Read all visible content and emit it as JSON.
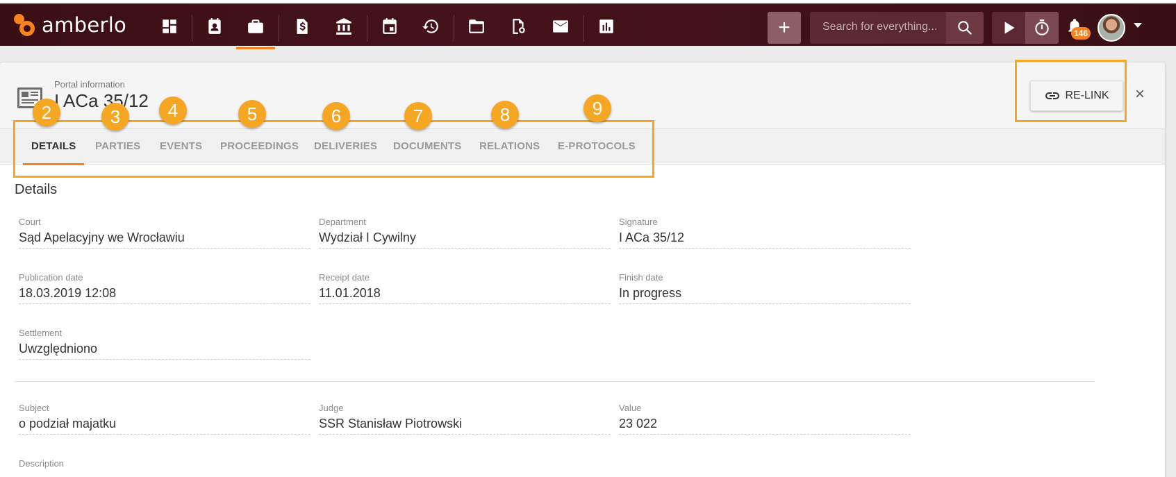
{
  "app": {
    "name": "amberlo"
  },
  "nav": {
    "icons": [
      "dashboard-icon",
      "contacts-icon",
      "briefcase-icon",
      "billing-icon",
      "bank-icon",
      "calendar-icon",
      "time-history-icon",
      "folder-icon",
      "certificate-icon",
      "mail-icon",
      "reports-icon"
    ],
    "active": "briefcase-icon"
  },
  "search": {
    "placeholder": "Search for everything..."
  },
  "notifications": {
    "count": "146"
  },
  "header": {
    "label": "Portal information",
    "title": "I ACa 35/12",
    "relink_label": "RE-LINK",
    "close_label": "×"
  },
  "tabs": [
    {
      "label": "DETAILS",
      "active": true,
      "marker": "2"
    },
    {
      "label": "PARTIES",
      "marker": "3"
    },
    {
      "label": "EVENTS",
      "marker": "4"
    },
    {
      "label": "PROCEEDINGS",
      "marker": "5"
    },
    {
      "label": "DELIVERIES",
      "marker": "6"
    },
    {
      "label": "DOCUMENTS",
      "marker": "7"
    },
    {
      "label": "RELATIONS",
      "marker": "8"
    },
    {
      "label": "E-PROTOCOLS",
      "marker": "9"
    }
  ],
  "details": {
    "section_title": "Details",
    "fields": [
      {
        "label": "Court",
        "value": "Sąd Apelacyjny we Wrocławiu"
      },
      {
        "label": "Department",
        "value": "Wydział I Cywilny"
      },
      {
        "label": "Signature",
        "value": "I ACa 35/12"
      },
      {
        "label": "Publication date",
        "value": "18.03.2019 12:08"
      },
      {
        "label": "Receipt date",
        "value": "11.01.2018"
      },
      {
        "label": "Finish date",
        "value": "In progress"
      },
      {
        "label": "Settlement",
        "value": "Uwzględniono"
      },
      {
        "label": "Subject",
        "value": "o podział majatku"
      },
      {
        "label": "Judge",
        "value": "SSR Stanisław Piotrowski"
      },
      {
        "label": "Value",
        "value": "23 022"
      },
      {
        "label": "Description",
        "value": ""
      }
    ]
  },
  "colors": {
    "topbar": "#3a0f14",
    "accent": "#f7831f",
    "annotation": "#f5a623"
  }
}
